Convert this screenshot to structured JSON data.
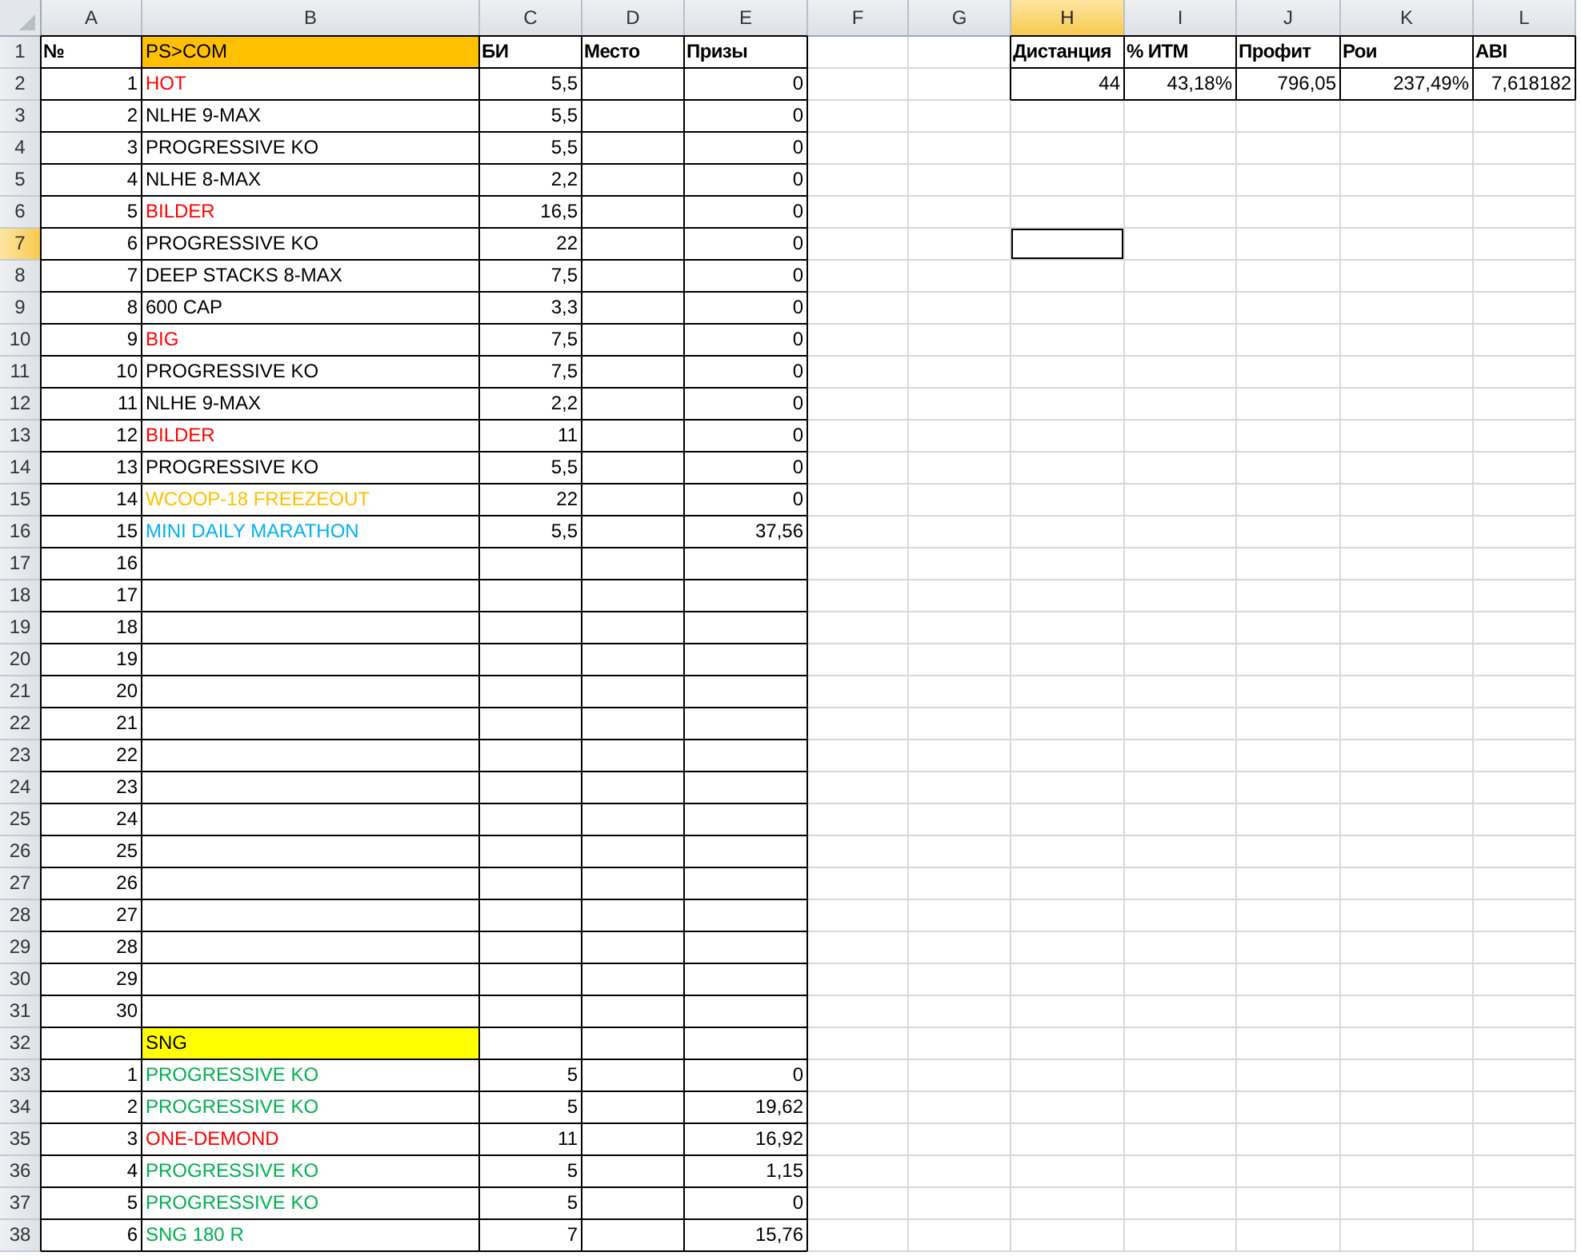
{
  "columns": [
    {
      "label": "A",
      "selected": false
    },
    {
      "label": "B",
      "selected": false
    },
    {
      "label": "C",
      "selected": false
    },
    {
      "label": "D",
      "selected": false
    },
    {
      "label": "E",
      "selected": false
    },
    {
      "label": "F",
      "selected": false
    },
    {
      "label": "G",
      "selected": false
    },
    {
      "label": "H",
      "selected": true
    },
    {
      "label": "I",
      "selected": false
    },
    {
      "label": "J",
      "selected": false
    },
    {
      "label": "K",
      "selected": false
    },
    {
      "label": "L",
      "selected": false
    }
  ],
  "rows": [
    {
      "label": "1",
      "selected": false,
      "cells": {
        "A": {
          "text": "№",
          "kind": "header"
        },
        "B": {
          "text": "PS>COM",
          "kind": "filled",
          "color": "#ffc000"
        },
        "C": {
          "text": "БИ",
          "kind": "header"
        },
        "D": {
          "text": "Место",
          "kind": "header"
        },
        "E": {
          "text": "Призы",
          "kind": "header"
        },
        "H": {
          "text": "Дистанция",
          "kind": "header"
        },
        "I": {
          "text": "% ИТМ",
          "kind": "header"
        },
        "J": {
          "text": "Профит",
          "kind": "header"
        },
        "K": {
          "text": "Рои",
          "kind": "header"
        },
        "L": {
          "text": "ABI",
          "kind": "header"
        }
      }
    },
    {
      "label": "2",
      "selected": false,
      "cells": {
        "A": {
          "text": "1",
          "kind": "number"
        },
        "B": {
          "text": "HOT",
          "kind": "text",
          "color": "#ff0000"
        },
        "C": {
          "text": "5,5",
          "kind": "number"
        },
        "E": {
          "text": "0",
          "kind": "number"
        },
        "H": {
          "text": "44",
          "kind": "number"
        },
        "I": {
          "text": "43,18%",
          "kind": "number"
        },
        "J": {
          "text": "796,05",
          "kind": "number"
        },
        "K": {
          "text": "237,49%",
          "kind": "number"
        },
        "L": {
          "text": "7,618182",
          "kind": "number"
        }
      }
    },
    {
      "label": "3",
      "selected": false,
      "cells": {
        "A": {
          "text": "2",
          "kind": "number"
        },
        "B": {
          "text": "NLHE 9-MAX",
          "kind": "text"
        },
        "C": {
          "text": "5,5",
          "kind": "number"
        },
        "E": {
          "text": "0",
          "kind": "number"
        }
      }
    },
    {
      "label": "4",
      "selected": false,
      "cells": {
        "A": {
          "text": "3",
          "kind": "number"
        },
        "B": {
          "text": "PROGRESSIVE KO",
          "kind": "text"
        },
        "C": {
          "text": "5,5",
          "kind": "number"
        },
        "E": {
          "text": "0",
          "kind": "number"
        }
      }
    },
    {
      "label": "5",
      "selected": false,
      "cells": {
        "A": {
          "text": "4",
          "kind": "number"
        },
        "B": {
          "text": "NLHE 8-MAX",
          "kind": "text"
        },
        "C": {
          "text": "2,2",
          "kind": "number"
        },
        "E": {
          "text": "0",
          "kind": "number"
        }
      }
    },
    {
      "label": "6",
      "selected": false,
      "cells": {
        "A": {
          "text": "5",
          "kind": "number"
        },
        "B": {
          "text": "BILDER",
          "kind": "text",
          "color": "#ff0000"
        },
        "C": {
          "text": "16,5",
          "kind": "number"
        },
        "E": {
          "text": "0",
          "kind": "number"
        }
      }
    },
    {
      "label": "7",
      "selected": true,
      "cells": {
        "A": {
          "text": "6",
          "kind": "number"
        },
        "B": {
          "text": "PROGRESSIVE KO",
          "kind": "text"
        },
        "C": {
          "text": "22",
          "kind": "number"
        },
        "E": {
          "text": "0",
          "kind": "number"
        }
      }
    },
    {
      "label": "8",
      "selected": false,
      "cells": {
        "A": {
          "text": "7",
          "kind": "number"
        },
        "B": {
          "text": "DEEP STACKS 8-MAX",
          "kind": "text"
        },
        "C": {
          "text": "7,5",
          "kind": "number"
        },
        "E": {
          "text": "0",
          "kind": "number"
        }
      }
    },
    {
      "label": "9",
      "selected": false,
      "cells": {
        "A": {
          "text": "8",
          "kind": "number"
        },
        "B": {
          "text": "600 CAP",
          "kind": "text"
        },
        "C": {
          "text": "3,3",
          "kind": "number"
        },
        "E": {
          "text": "0",
          "kind": "number"
        }
      }
    },
    {
      "label": "10",
      "selected": false,
      "cells": {
        "A": {
          "text": "9",
          "kind": "number"
        },
        "B": {
          "text": "BIG",
          "kind": "text",
          "color": "#ff0000"
        },
        "C": {
          "text": "7,5",
          "kind": "number"
        },
        "E": {
          "text": "0",
          "kind": "number"
        }
      }
    },
    {
      "label": "11",
      "selected": false,
      "cells": {
        "A": {
          "text": "10",
          "kind": "number"
        },
        "B": {
          "text": "PROGRESSIVE KO",
          "kind": "text"
        },
        "C": {
          "text": "7,5",
          "kind": "number"
        },
        "E": {
          "text": "0",
          "kind": "number"
        }
      }
    },
    {
      "label": "12",
      "selected": false,
      "cells": {
        "A": {
          "text": "11",
          "kind": "number"
        },
        "B": {
          "text": "NLHE 9-MAX",
          "kind": "text"
        },
        "C": {
          "text": "2,2",
          "kind": "number"
        },
        "E": {
          "text": "0",
          "kind": "number"
        }
      }
    },
    {
      "label": "13",
      "selected": false,
      "cells": {
        "A": {
          "text": "12",
          "kind": "number"
        },
        "B": {
          "text": "BILDER",
          "kind": "text",
          "color": "#ff0000"
        },
        "C": {
          "text": "11",
          "kind": "number"
        },
        "E": {
          "text": "0",
          "kind": "number"
        }
      }
    },
    {
      "label": "14",
      "selected": false,
      "cells": {
        "A": {
          "text": "13",
          "kind": "number"
        },
        "B": {
          "text": "PROGRESSIVE KO",
          "kind": "text"
        },
        "C": {
          "text": "5,5",
          "kind": "number"
        },
        "E": {
          "text": "0",
          "kind": "number"
        }
      }
    },
    {
      "label": "15",
      "selected": false,
      "cells": {
        "A": {
          "text": "14",
          "kind": "number"
        },
        "B": {
          "text": "WCOOP-18 FREEZEOUT",
          "kind": "text",
          "color": "#ffc000"
        },
        "C": {
          "text": "22",
          "kind": "number"
        },
        "E": {
          "text": "0",
          "kind": "number"
        }
      }
    },
    {
      "label": "16",
      "selected": false,
      "cells": {
        "A": {
          "text": "15",
          "kind": "number"
        },
        "B": {
          "text": "MINI DAILY MARATHON",
          "kind": "text",
          "color": "#00b0f0"
        },
        "C": {
          "text": "5,5",
          "kind": "number"
        },
        "E": {
          "text": "37,56",
          "kind": "number"
        }
      }
    },
    {
      "label": "17",
      "selected": false,
      "cells": {
        "A": {
          "text": "16",
          "kind": "number"
        }
      }
    },
    {
      "label": "18",
      "selected": false,
      "cells": {
        "A": {
          "text": "17",
          "kind": "number"
        }
      }
    },
    {
      "label": "19",
      "selected": false,
      "cells": {
        "A": {
          "text": "18",
          "kind": "number"
        }
      }
    },
    {
      "label": "20",
      "selected": false,
      "cells": {
        "A": {
          "text": "19",
          "kind": "number"
        }
      }
    },
    {
      "label": "21",
      "selected": false,
      "cells": {
        "A": {
          "text": "20",
          "kind": "number"
        }
      }
    },
    {
      "label": "22",
      "selected": false,
      "cells": {
        "A": {
          "text": "21",
          "kind": "number"
        }
      }
    },
    {
      "label": "23",
      "selected": false,
      "cells": {
        "A": {
          "text": "22",
          "kind": "number"
        }
      }
    },
    {
      "label": "24",
      "selected": false,
      "cells": {
        "A": {
          "text": "23",
          "kind": "number"
        }
      }
    },
    {
      "label": "25",
      "selected": false,
      "cells": {
        "A": {
          "text": "24",
          "kind": "number"
        }
      }
    },
    {
      "label": "26",
      "selected": false,
      "cells": {
        "A": {
          "text": "25",
          "kind": "number"
        }
      }
    },
    {
      "label": "27",
      "selected": false,
      "cells": {
        "A": {
          "text": "26",
          "kind": "number"
        }
      }
    },
    {
      "label": "28",
      "selected": false,
      "cells": {
        "A": {
          "text": "27",
          "kind": "number"
        }
      }
    },
    {
      "label": "29",
      "selected": false,
      "cells": {
        "A": {
          "text": "28",
          "kind": "number"
        }
      }
    },
    {
      "label": "30",
      "selected": false,
      "cells": {
        "A": {
          "text": "29",
          "kind": "number"
        }
      }
    },
    {
      "label": "31",
      "selected": false,
      "cells": {
        "A": {
          "text": "30",
          "kind": "number"
        }
      }
    },
    {
      "label": "32",
      "selected": false,
      "cells": {
        "B": {
          "text": "SNG",
          "kind": "filled",
          "color": "#ffff00"
        }
      }
    },
    {
      "label": "33",
      "selected": false,
      "cells": {
        "A": {
          "text": "1",
          "kind": "number"
        },
        "B": {
          "text": "PROGRESSIVE KO",
          "kind": "text",
          "color": "#00b050"
        },
        "C": {
          "text": "5",
          "kind": "number"
        },
        "E": {
          "text": "0",
          "kind": "number"
        }
      }
    },
    {
      "label": "34",
      "selected": false,
      "cells": {
        "A": {
          "text": "2",
          "kind": "number"
        },
        "B": {
          "text": "PROGRESSIVE KO",
          "kind": "text",
          "color": "#00b050"
        },
        "C": {
          "text": "5",
          "kind": "number"
        },
        "E": {
          "text": "19,62",
          "kind": "number"
        }
      }
    },
    {
      "label": "35",
      "selected": false,
      "cells": {
        "A": {
          "text": "3",
          "kind": "number"
        },
        "B": {
          "text": "ONE-DEMOND",
          "kind": "text",
          "color": "#ff0000"
        },
        "C": {
          "text": "11",
          "kind": "number"
        },
        "E": {
          "text": "16,92",
          "kind": "number"
        }
      }
    },
    {
      "label": "36",
      "selected": false,
      "cells": {
        "A": {
          "text": "4",
          "kind": "number"
        },
        "B": {
          "text": "PROGRESSIVE KO",
          "kind": "text",
          "color": "#00b050"
        },
        "C": {
          "text": "5",
          "kind": "number"
        },
        "E": {
          "text": "1,15",
          "kind": "number"
        }
      }
    },
    {
      "label": "37",
      "selected": false,
      "cells": {
        "A": {
          "text": "5",
          "kind": "number"
        },
        "B": {
          "text": "PROGRESSIVE KO",
          "kind": "text",
          "color": "#00b050"
        },
        "C": {
          "text": "5",
          "kind": "number"
        },
        "E": {
          "text": "0",
          "kind": "number"
        }
      }
    },
    {
      "label": "38",
      "selected": false,
      "cells": {
        "A": {
          "text": "6",
          "kind": "number"
        },
        "B": {
          "text": "SNG 180 R",
          "kind": "text",
          "color": "#00b050"
        },
        "C": {
          "text": "7",
          "kind": "number"
        },
        "E": {
          "text": "15,76",
          "kind": "number"
        }
      }
    }
  ]
}
